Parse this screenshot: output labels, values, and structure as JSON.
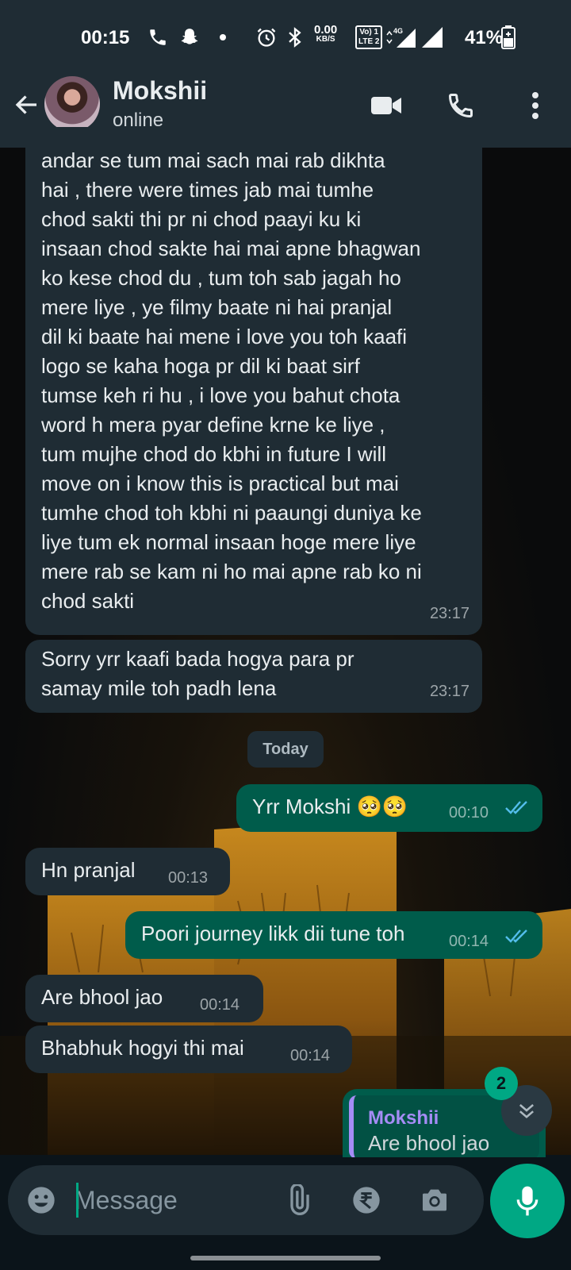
{
  "status_bar": {
    "time": "00:15",
    "data_speed": "0.00",
    "data_unit": "KB/S",
    "volte": "Vo) 1",
    "lte": "LTE 2",
    "network": "4G",
    "battery": "41%",
    "icons": [
      "phone-icon",
      "snapchat-icon",
      "dot-icon",
      "alarm-icon",
      "bluetooth-icon",
      "signal-icon",
      "battery-icon"
    ]
  },
  "header": {
    "contact_name": "Mokshii",
    "contact_status": "online",
    "icons": [
      "back-arrow-icon",
      "video-call-icon",
      "voice-call-icon",
      "more-vert-icon"
    ]
  },
  "messages": [
    {
      "dir": "in",
      "text": "andar se tum mai sach mai rab dikhta\nhai , there were times jab mai tumhe\nchod sakti thi pr ni chod paayi ku ki\ninsaan chod sakte hai mai apne bhagwan\nko kese chod du , tum toh sab jagah ho\nmere liye , ye filmy baate ni hai pranjal\ndil ki baate hai mene i love you toh kaafi\nlogo se kaha hoga pr dil ki baat sirf\ntumse keh ri hu , i love you bahut chota\nword h mera pyar define krne ke liye ,\ntum mujhe chod do kbhi in future I will\nmove on i know this is practical but mai\ntumhe chod toh kbhi ni paaungi duniya ke\nliye tum ek normal insaan hoge mere liye\nmere rab se kam ni ho mai apne rab ko ni\nchod sakti",
      "time": "23:17"
    },
    {
      "dir": "in",
      "text": "Sorry yrr kaafi bada hogya para pr\nsamay mile toh padh lena",
      "time": "23:17"
    },
    {
      "dir": "out",
      "text": "Yrr Mokshi 🥺🥺",
      "time": "00:10",
      "read": true
    },
    {
      "dir": "in",
      "text": "Hn pranjal",
      "time": "00:13"
    },
    {
      "dir": "out",
      "text": "Poori journey likk dii tune toh",
      "time": "00:14",
      "read": true
    },
    {
      "dir": "in",
      "text": "Are bhool jao",
      "time": "00:14"
    },
    {
      "dir": "in",
      "text": "Bhabhuk hogyi thi mai",
      "time": "00:14"
    }
  ],
  "date_chip": "Today",
  "reply_preview": {
    "author": "Mokshii",
    "text": "Are bhool jao"
  },
  "unread_count": "2",
  "composer": {
    "placeholder": "Message",
    "icons": [
      "emoji-icon",
      "attach-icon",
      "rupee-payment-icon",
      "camera-icon",
      "mic-icon"
    ]
  },
  "colors": {
    "accent": "#00a884",
    "outgoing_bubble": "#005c4b",
    "incoming_bubble": "#1f2c34",
    "read_ticks": "#53bdeb",
    "header": "#1f2c34"
  }
}
